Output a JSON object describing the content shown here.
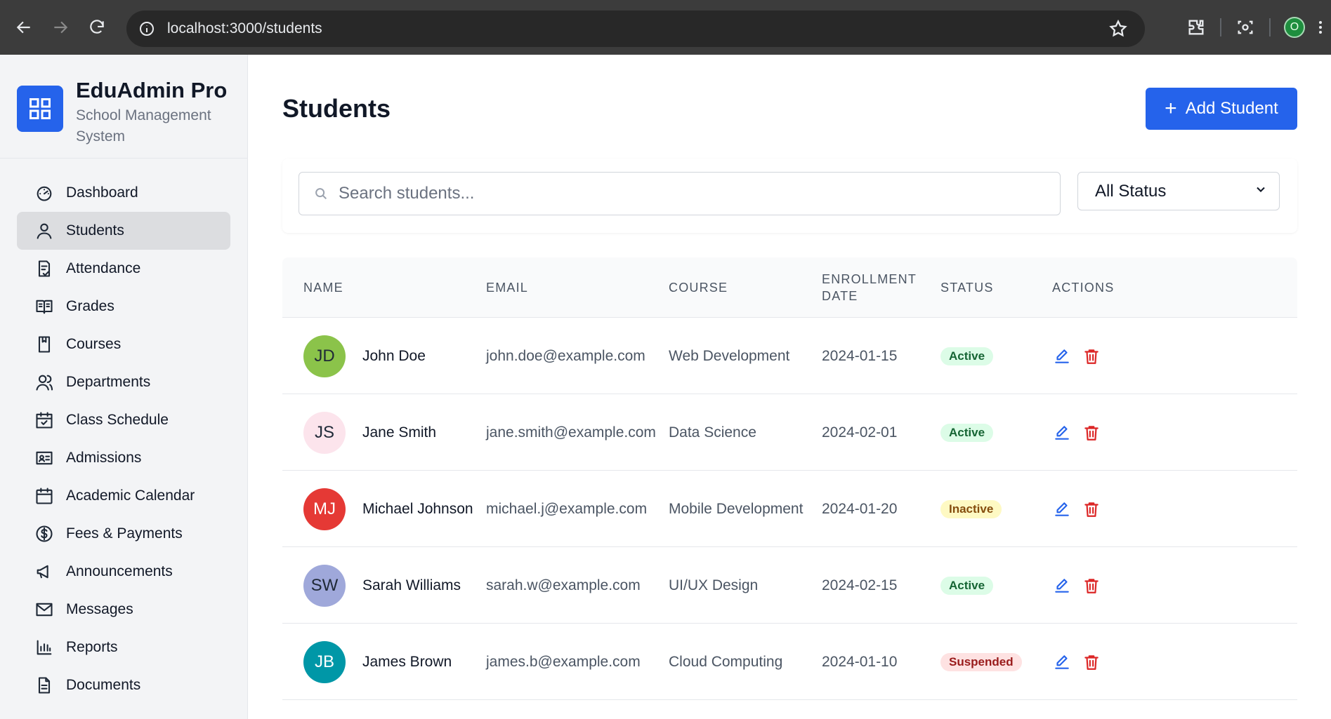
{
  "browser": {
    "url": "localhost:3000/students",
    "profile_initial": "O"
  },
  "sidebar": {
    "brand_title": "EduAdmin Pro",
    "brand_subtitle": "School Management System",
    "items": [
      {
        "label": "Dashboard",
        "icon": "dashboard-icon",
        "active": false
      },
      {
        "label": "Students",
        "icon": "user-icon",
        "active": true
      },
      {
        "label": "Attendance",
        "icon": "attendance-icon",
        "active": false
      },
      {
        "label": "Grades",
        "icon": "book-open-icon",
        "active": false
      },
      {
        "label": "Courses",
        "icon": "book-icon",
        "active": false
      },
      {
        "label": "Departments",
        "icon": "users-icon",
        "active": false
      },
      {
        "label": "Class Schedule",
        "icon": "calendar-check-icon",
        "active": false
      },
      {
        "label": "Admissions",
        "icon": "id-card-icon",
        "active": false
      },
      {
        "label": "Academic Calendar",
        "icon": "calendar-icon",
        "active": false
      },
      {
        "label": "Fees & Payments",
        "icon": "dollar-icon",
        "active": false
      },
      {
        "label": "Announcements",
        "icon": "megaphone-icon",
        "active": false
      },
      {
        "label": "Messages",
        "icon": "mail-icon",
        "active": false
      },
      {
        "label": "Reports",
        "icon": "bar-chart-icon",
        "active": false
      },
      {
        "label": "Documents",
        "icon": "document-icon",
        "active": false
      }
    ]
  },
  "main": {
    "title": "Students",
    "add_button": "Add Student",
    "search_placeholder": "Search students...",
    "status_filter": "All Status",
    "columns": [
      "NAME",
      "EMAIL",
      "COURSE",
      "ENROLLMENT DATE",
      "STATUS",
      "ACTIONS"
    ],
    "students": [
      {
        "initials": "JD",
        "name": "John Doe",
        "email": "john.doe@example.com",
        "course": "Web Development",
        "date": "2024-01-15",
        "status": "Active",
        "avatar_bg": "#8bc34a",
        "avatar_fg": "#1f2937"
      },
      {
        "initials": "JS",
        "name": "Jane Smith",
        "email": "jane.smith@example.com",
        "course": "Data Science",
        "date": "2024-02-01",
        "status": "Active",
        "avatar_bg": "#fce4ec",
        "avatar_fg": "#1f2937"
      },
      {
        "initials": "MJ",
        "name": "Michael Johnson",
        "email": "michael.j@example.com",
        "course": "Mobile Development",
        "date": "2024-01-20",
        "status": "Inactive",
        "avatar_bg": "#e53935",
        "avatar_fg": "#ffffff"
      },
      {
        "initials": "SW",
        "name": "Sarah Williams",
        "email": "sarah.w@example.com",
        "course": "UI/UX Design",
        "date": "2024-02-15",
        "status": "Active",
        "avatar_bg": "#9fa8da",
        "avatar_fg": "#1f2937"
      },
      {
        "initials": "JB",
        "name": "James Brown",
        "email": "james.b@example.com",
        "course": "Cloud Computing",
        "date": "2024-01-10",
        "status": "Suspended",
        "avatar_bg": "#0097a7",
        "avatar_fg": "#ffffff"
      }
    ],
    "status_colors": {
      "Active": {
        "bg": "#dcfce7",
        "fg": "#166534"
      },
      "Inactive": {
        "bg": "#fef9c3",
        "fg": "#854d0e"
      },
      "Suspended": {
        "bg": "#fee2e2",
        "fg": "#991b1b"
      }
    },
    "accent_color": "#2563eb"
  }
}
